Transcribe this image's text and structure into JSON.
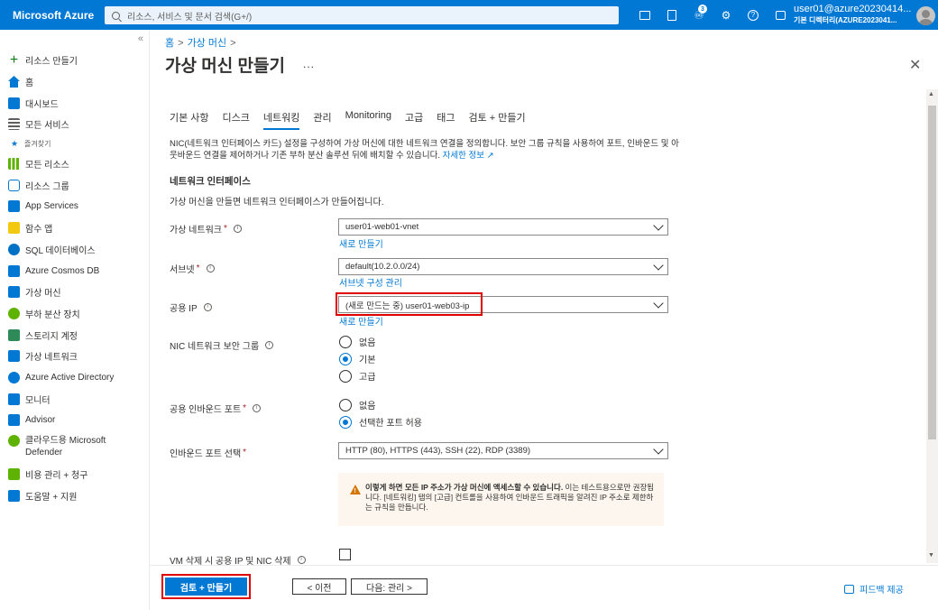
{
  "topbar": {
    "brand": "Microsoft Azure",
    "search_placeholder": "리소스, 서비스 및 문서 검색(G+/)",
    "notification_count": "3",
    "user_email": "user01@azure20230414...",
    "tenant": "기본 디렉터리(AZURE2023041..."
  },
  "sidebar": {
    "collapse_glyph": "«",
    "items": [
      {
        "label": "리소스 만들기",
        "icon": "plus-icon",
        "color": "#107c10"
      },
      {
        "label": "홈",
        "icon": "home-icon",
        "color": "#0078d4"
      },
      {
        "label": "대시보드",
        "icon": "dashboard-icon",
        "color": "#0078d4"
      },
      {
        "label": "모든 서비스",
        "icon": "list-icon",
        "color": "#605e5c"
      },
      {
        "label": "즐겨찾기",
        "icon": "star-icon",
        "color": "#0078d4"
      },
      {
        "label": "모든 리소스",
        "icon": "grid-icon",
        "color": "#5db300"
      },
      {
        "label": "리소스 그룹",
        "icon": "resource-group-icon",
        "color": "#0078d4"
      },
      {
        "label": "App Services",
        "icon": "app-services-icon",
        "color": "#0078d4"
      },
      {
        "label": "함수 앱",
        "icon": "function-app-icon",
        "color": "#f2c811"
      },
      {
        "label": "SQL 데이터베이스",
        "icon": "sql-database-icon",
        "color": "#0072c6"
      },
      {
        "label": "Azure Cosmos DB",
        "icon": "cosmos-db-icon",
        "color": "#0078d4"
      },
      {
        "label": "가상 머신",
        "icon": "virtual-machine-icon",
        "color": "#0078d4"
      },
      {
        "label": "부하 분산 장치",
        "icon": "load-balancer-icon",
        "color": "#5db300"
      },
      {
        "label": "스토리지 계정",
        "icon": "storage-account-icon",
        "color": "#2e8b57"
      },
      {
        "label": "가상 네트워크",
        "icon": "virtual-network-icon",
        "color": "#0078d4"
      },
      {
        "label": "Azure Active Directory",
        "icon": "active-directory-icon",
        "color": "#0078d4"
      },
      {
        "label": "모니터",
        "icon": "monitor-icon",
        "color": "#0078d4"
      },
      {
        "label": "Advisor",
        "icon": "advisor-icon",
        "color": "#0078d4"
      },
      {
        "label": "클라우드용 Microsoft Defender",
        "icon": "defender-icon",
        "color": "#5db300"
      },
      {
        "label": "비용 관리 + 청구",
        "icon": "cost-management-icon",
        "color": "#5db300"
      },
      {
        "label": "도움말 + 지원",
        "icon": "help-support-icon",
        "color": "#0078d4"
      }
    ]
  },
  "breadcrumb": {
    "home": "홈",
    "vm": "가상 머신"
  },
  "page": {
    "title": "가상 머신 만들기",
    "more": "...",
    "close": "✕"
  },
  "tabs": [
    "기본 사항",
    "디스크",
    "네트워킹",
    "관리",
    "Monitoring",
    "고급",
    "태그",
    "검토 + 만들기"
  ],
  "active_tab": "네트워킹",
  "description": {
    "text": "NIC(네트워크 인터페이스 카드) 설정을 구성하여 가상 머신에 대한 네트워크 연결을 정의합니다. 보안 그룹 규칙을 사용하여 포트, 인바운드 및 아웃바운드 연결을 제어하거나 기존 부하 분산 솔루션 뒤에 배치할 수 있습니다.",
    "link": "자세한 정보"
  },
  "section": {
    "title": "네트워크 인터페이스",
    "desc": "가상 머신을 만들면 네트워크 인터페이스가 만들어집니다."
  },
  "fields": {
    "vnet": {
      "label": "가상 네트워크",
      "value": "user01-web01-vnet",
      "link": "새로 만들기"
    },
    "subnet": {
      "label": "서브넷",
      "value": "default(10.2.0.0/24)",
      "link": "서브넷 구성 관리"
    },
    "public_ip": {
      "label": "공용 IP",
      "value": "(새로 만드는 중) user01-web03-ip",
      "link": "새로 만들기"
    },
    "nsg": {
      "label": "NIC 네트워크 보안 그룹",
      "options": [
        "없음",
        "기본",
        "고급"
      ],
      "selected": "기본"
    },
    "inbound_ports": {
      "label": "공용 인바운드 포트",
      "options": [
        "없음",
        "선택한 포트 허용"
      ],
      "selected": "선택한 포트 허용"
    },
    "select_ports": {
      "label": "인바운드 포트 선택",
      "value": "HTTP (80), HTTPS (443), SSH (22), RDP (3389)"
    },
    "delete_ip": {
      "label": "VM 삭제 시 공용 IP 및 NIC 삭제",
      "checked": false
    }
  },
  "warning": {
    "bold": "이렇게 하면 모든 IP 주소가 가상 머신에 액세스할 수 있습니다.",
    "text": " 이는 테스트용으로만 권장됩니다. [네트워킹] 탭의 [고급] 컨트롤을 사용하여 인바운드 트래픽을 알려진 IP 주소로 제한하는 규칙을 만듭니다."
  },
  "footer": {
    "review_create": "검토 + 만들기",
    "prev": "< 이전",
    "next": "다음: 관리 >",
    "feedback": "피드백 제공"
  },
  "colors": {
    "accent": "#0078d4",
    "highlight": "#e00000",
    "warning_icon": "#d47500"
  }
}
